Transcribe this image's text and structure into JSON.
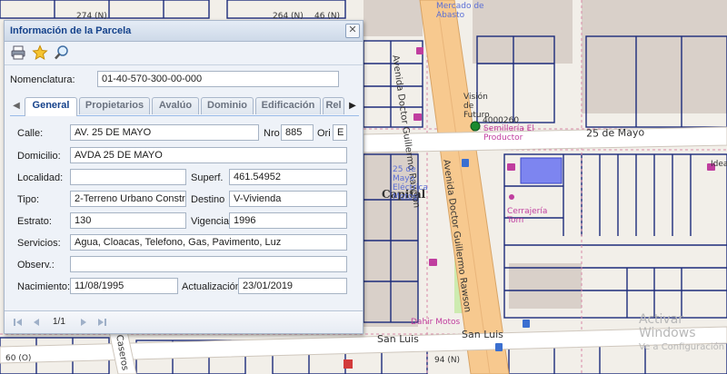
{
  "map": {
    "street_labels": {
      "calle_25_de_mayo": "25 de Mayo",
      "av_doctor_rawson_1": "Avenida Doctor Guillermo Rawson",
      "av_doctor_rawson_2": "Avenida Doctor Guillermo Rawson",
      "san_luis_1": "San Luis",
      "san_luis_2": "San Luis",
      "caseros": "Caseros"
    },
    "place_labels": {
      "mercado": "Mercado de Abasto",
      "vision": "Visión de Futuro",
      "semilleria": "Semillería El Productor",
      "semilleria_num": "4000260",
      "capital": "Capital",
      "electrica": "25 de Mayo Eléctrica Motos",
      "cerrajeria": "Cerrajería Tom",
      "motos": "Dahir Motos",
      "ideas": "Ideas"
    },
    "house_numbers": [
      "274 (N)",
      "264 (N)",
      "46 (N)",
      "94 (N)",
      "60 (O)"
    ]
  },
  "watermark": {
    "line1": "Activar Windows",
    "line2": "Ve a Configuración"
  },
  "panel": {
    "title": "Información de la Parcela",
    "icons": {
      "print": "print-icon",
      "favorite": "star-icon",
      "search": "zoom-icon",
      "close": "close-icon"
    },
    "nomenclatura": {
      "label": "Nomenclatura:",
      "value": "01-40-570-300-00-000"
    },
    "tabs": [
      {
        "label": "General",
        "active": true
      },
      {
        "label": "Propietarios",
        "active": false
      },
      {
        "label": "Avalúo",
        "active": false
      },
      {
        "label": "Dominio",
        "active": false
      },
      {
        "label": "Edificación",
        "active": false
      },
      {
        "label": "Rel",
        "active": false
      }
    ],
    "fields": {
      "calle": {
        "label": "Calle:",
        "value": "AV. 25 DE MAYO"
      },
      "nro": {
        "label": "Nro",
        "value": "885"
      },
      "ori": {
        "label": "Ori",
        "value": "E"
      },
      "domicilio": {
        "label": "Domicilio:",
        "value": "AVDA 25 DE MAYO"
      },
      "localidad": {
        "label": "Localidad:",
        "value": ""
      },
      "superf": {
        "label": "Superf.",
        "value": "461.54952"
      },
      "tipo": {
        "label": "Tipo:",
        "value": "2-Terreno Urbano Constru"
      },
      "destino": {
        "label": "Destino",
        "value": "V-Vivienda"
      },
      "estrato": {
        "label": "Estrato:",
        "value": "130"
      },
      "vigencia": {
        "label": "Vigencia",
        "value": "1996"
      },
      "servicios": {
        "label": "Servicios:",
        "value": "Agua, Cloacas, Telefono, Gas, Pavimento, Luz"
      },
      "observ": {
        "label": "Observ.:",
        "value": ""
      },
      "nacimiento": {
        "label": "Nacimiento:",
        "value": "11/08/1995"
      },
      "actualizacion": {
        "label": "Actualización",
        "value": "23/01/2019"
      }
    },
    "pager": {
      "text": "1/1"
    }
  },
  "colors": {
    "parcel_line": "#1c2b7a",
    "highlight": "#7d85f0",
    "road": "#f7c98f",
    "panel_title": "#15428b"
  }
}
